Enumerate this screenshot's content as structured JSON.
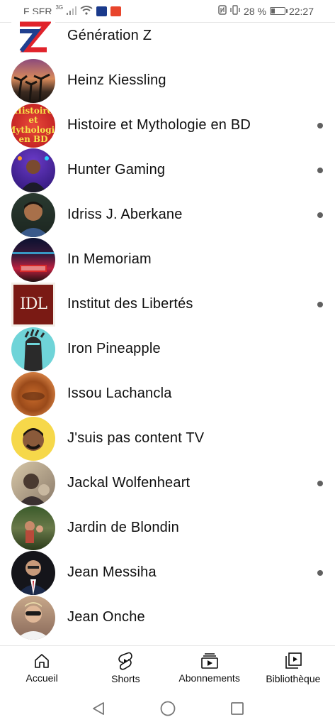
{
  "status_bar": {
    "carrier": "F SFR",
    "network": "3G",
    "battery_percent": "28 %",
    "time": "22:27"
  },
  "channels": [
    {
      "name": "Génération Z",
      "avatar": "generation-z-logo",
      "new_content": false
    },
    {
      "name": "Heinz Kiessling",
      "avatar": "palm-trees-sunset",
      "new_content": false
    },
    {
      "name": "Histoire et Mythologie en BD",
      "avatar": "histoire-mythologie-logo",
      "new_content": true
    },
    {
      "name": "Hunter Gaming",
      "avatar": "hunter-gaming-portrait",
      "new_content": true
    },
    {
      "name": "Idriss J. Aberkane",
      "avatar": "man-portrait",
      "new_content": true
    },
    {
      "name": "In Memoriam",
      "avatar": "neon-street",
      "new_content": false
    },
    {
      "name": "Institut des Libertés",
      "avatar": "idl-logo",
      "new_content": true
    },
    {
      "name": "Iron Pineapple",
      "avatar": "armored-knight",
      "new_content": false
    },
    {
      "name": "Issou Lachancla",
      "avatar": "blurry-face",
      "new_content": false
    },
    {
      "name": "J'suis pas content TV",
      "avatar": "jspc-logo",
      "new_content": false
    },
    {
      "name": "Jackal Wolfenheart",
      "avatar": "jackal-photo",
      "new_content": true
    },
    {
      "name": "Jardin de Blondin",
      "avatar": "garden-photo",
      "new_content": false
    },
    {
      "name": "Jean Messiha",
      "avatar": "man-in-suit",
      "new_content": true
    },
    {
      "name": "Jean Onche",
      "avatar": "man-with-sunglasses",
      "new_content": false
    }
  ],
  "bottom_nav": [
    {
      "label": "Accueil",
      "icon": "home-icon"
    },
    {
      "label": "Shorts",
      "icon": "shorts-icon"
    },
    {
      "label": "Abonnements",
      "icon": "subscriptions-icon"
    },
    {
      "label": "Bibliothèque",
      "icon": "library-icon"
    }
  ],
  "system_nav": [
    "back-icon",
    "home-circle-icon",
    "recents-icon"
  ],
  "colors": {
    "text": "#0f0f0f",
    "new_content_dot": "#606060",
    "divider": "#e5e5e5"
  }
}
